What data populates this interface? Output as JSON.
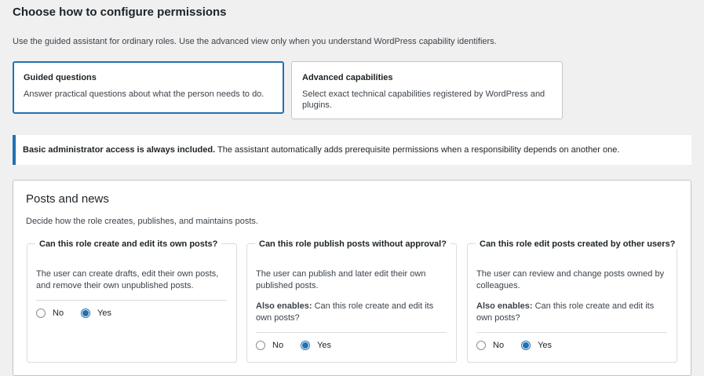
{
  "header": {
    "title": "Choose how to configure permissions",
    "intro": "Use the guided assistant for ordinary roles. Use the advanced view only when you understand WordPress capability identifiers."
  },
  "modes": [
    {
      "title": "Guided questions",
      "desc": "Answer practical questions about what the person needs to do.",
      "selected": true
    },
    {
      "title": "Advanced capabilities",
      "desc": "Select exact technical capabilities registered by WordPress and plugins.",
      "selected": false
    }
  ],
  "notice": {
    "strong": "Basic administrator access is always included.",
    "text": " The assistant automatically adds prerequisite permissions when a responsibility depends on another one."
  },
  "section": {
    "title": "Posts and news",
    "desc": "Decide how the role creates, publishes, and maintains posts."
  },
  "questions": [
    {
      "legend": "Can this role create and edit its own posts?",
      "desc": "The user can create drafts, edit their own posts, and remove their own unpublished posts.",
      "also_label": "",
      "also_text": "",
      "no_label": "No",
      "yes_label": "Yes",
      "value": "Yes"
    },
    {
      "legend": "Can this role publish posts without approval?",
      "desc": "The user can publish and later edit their own published posts.",
      "also_label": "Also enables:",
      "also_text": " Can this role create and edit its own posts?",
      "no_label": "No",
      "yes_label": "Yes",
      "value": "Yes"
    },
    {
      "legend": "Can this role edit posts created by other users?",
      "desc": "The user can review and change posts owned by colleagues.",
      "also_label": "Also enables:",
      "also_text": " Can this role create and edit its own posts?",
      "no_label": "No",
      "yes_label": "Yes",
      "value": "Yes"
    }
  ],
  "colors": {
    "accent": "#2271b1",
    "background": "#f0f0f1",
    "border": "#c3c4c7"
  }
}
